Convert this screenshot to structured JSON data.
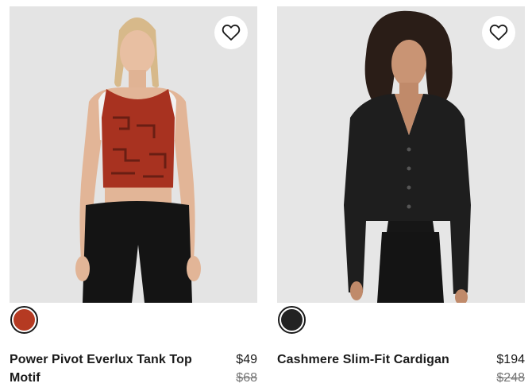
{
  "products": [
    {
      "name": "Power Pivot Everlux Tank Top Motif",
      "price": "$49",
      "original_price": "$68",
      "swatch_color": "#b53a22",
      "favorite_icon": "heart-outline-icon"
    },
    {
      "name": "Cashmere Slim-Fit Cardigan",
      "price": "$194",
      "original_price": "$248",
      "swatch_color": "#222222",
      "favorite_icon": "heart-outline-icon"
    }
  ]
}
